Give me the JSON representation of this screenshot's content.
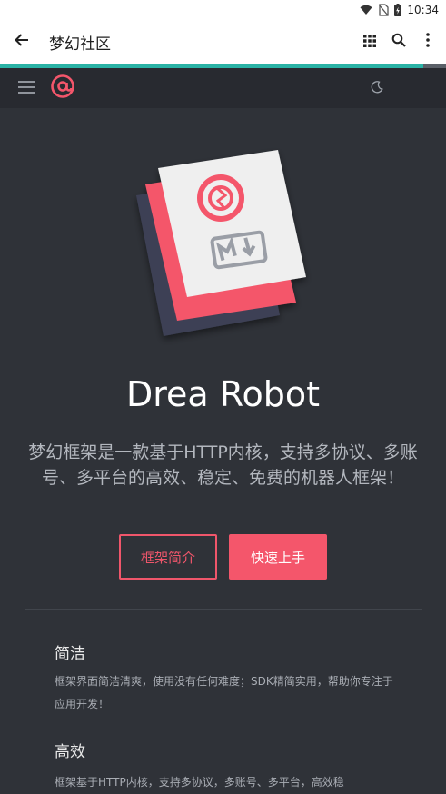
{
  "status_bar": {
    "time": "10:34",
    "wifi_icon": "wifi-icon",
    "sim_icon": "no-sim-icon",
    "battery_icon": "battery-charging-icon"
  },
  "app_bar": {
    "title": "梦幻社区",
    "back_icon": "arrow-left-icon",
    "grid_icon": "apps-grid-icon",
    "search_icon": "search-icon",
    "more_icon": "more-vertical-icon"
  },
  "page_load_progress": 0.95,
  "site_nav": {
    "menu_icon": "hamburger-menu-icon",
    "logo_icon": "at-logo-icon",
    "theme_icon": "moon-icon"
  },
  "hero": {
    "title": "Drea Robot",
    "tagline": "梦幻框架是一款基于HTTP内核，支持多协议、多账号、多平台的高效、稳定、免费的机器人框架！"
  },
  "buttons": {
    "intro": "框架简介",
    "quickstart": "快速上手"
  },
  "features": [
    {
      "title": "简洁",
      "desc": "框架界面简洁清爽，使用没有任何难度；SDK精简实用，帮助你专注于应用开发！"
    },
    {
      "title": "高效",
      "desc": "框架基于HTTP内核，支持多协议，多账号、多平台，高效稳"
    }
  ],
  "colors": {
    "accent": "#f4566b",
    "page_bg": "#2f3238",
    "nav_bg": "#282a30",
    "progress": "#2ab3a6"
  }
}
